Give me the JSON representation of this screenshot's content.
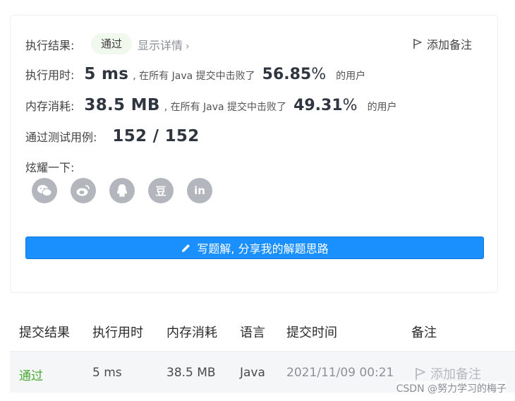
{
  "result": {
    "label": "执行结果:",
    "status": "通过",
    "detail_link": "显示详情",
    "detail_chevron": "›",
    "add_note": "添加备注"
  },
  "runtime": {
    "label": "执行用时:",
    "value": "5 ms",
    "mid": ", 在所有 Java 提交中击败了",
    "percent": "56.85",
    "percent_sign": "%",
    "tail": "的用户"
  },
  "memory": {
    "label": "内存消耗:",
    "value": "38.5 MB",
    "mid": ", 在所有 Java 提交中击败了",
    "percent": "49.31",
    "percent_sign": "%",
    "tail": "的用户"
  },
  "tests": {
    "label": "通过测试用例:",
    "value": "152 / 152"
  },
  "share": {
    "label": "炫耀一下:",
    "icons": [
      "wechat-icon",
      "weibo-icon",
      "qq-icon",
      "douban-icon",
      "linkedin-icon"
    ],
    "douban_glyph": "豆",
    "linkedin_glyph": "in"
  },
  "solution_button": "写题解, 分享我的解题思路",
  "table": {
    "headers": [
      "提交结果",
      "执行用时",
      "内存消耗",
      "语言",
      "提交时间",
      "备注"
    ],
    "row": {
      "result": "通过",
      "runtime": "5 ms",
      "memory": "38.5 MB",
      "language": "Java",
      "time": "2021/11/09 00:21",
      "note": "添加备注"
    }
  },
  "watermark": "CSDN @努力学习的梅子",
  "colors": {
    "accent": "#1a90ff",
    "pass": "#48a832",
    "badge_bg": "#f1f8ed",
    "icon_gray": "#b3b7bd"
  }
}
